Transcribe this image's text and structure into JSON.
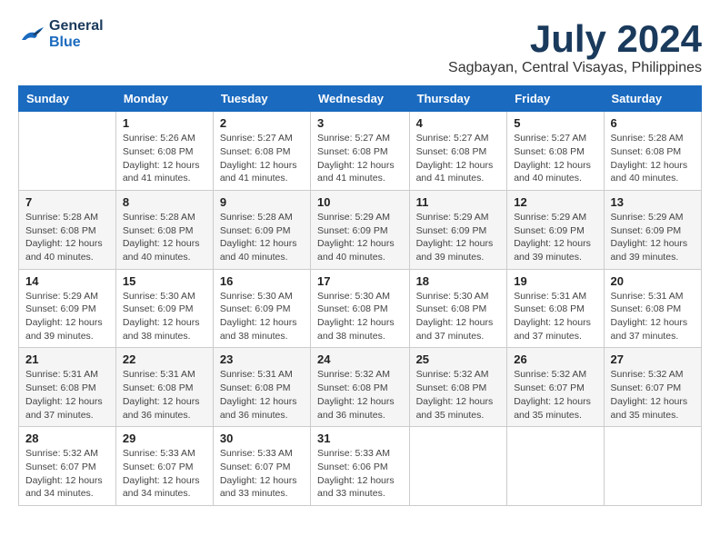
{
  "header": {
    "logo_general": "General",
    "logo_blue": "Blue",
    "month_title": "July 2024",
    "location": "Sagbayan, Central Visayas, Philippines"
  },
  "weekdays": [
    "Sunday",
    "Monday",
    "Tuesday",
    "Wednesday",
    "Thursday",
    "Friday",
    "Saturday"
  ],
  "weeks": [
    [
      {
        "day": "",
        "info": ""
      },
      {
        "day": "1",
        "info": "Sunrise: 5:26 AM\nSunset: 6:08 PM\nDaylight: 12 hours\nand 41 minutes."
      },
      {
        "day": "2",
        "info": "Sunrise: 5:27 AM\nSunset: 6:08 PM\nDaylight: 12 hours\nand 41 minutes."
      },
      {
        "day": "3",
        "info": "Sunrise: 5:27 AM\nSunset: 6:08 PM\nDaylight: 12 hours\nand 41 minutes."
      },
      {
        "day": "4",
        "info": "Sunrise: 5:27 AM\nSunset: 6:08 PM\nDaylight: 12 hours\nand 41 minutes."
      },
      {
        "day": "5",
        "info": "Sunrise: 5:27 AM\nSunset: 6:08 PM\nDaylight: 12 hours\nand 40 minutes."
      },
      {
        "day": "6",
        "info": "Sunrise: 5:28 AM\nSunset: 6:08 PM\nDaylight: 12 hours\nand 40 minutes."
      }
    ],
    [
      {
        "day": "7",
        "info": "Sunrise: 5:28 AM\nSunset: 6:08 PM\nDaylight: 12 hours\nand 40 minutes."
      },
      {
        "day": "8",
        "info": "Sunrise: 5:28 AM\nSunset: 6:08 PM\nDaylight: 12 hours\nand 40 minutes."
      },
      {
        "day": "9",
        "info": "Sunrise: 5:28 AM\nSunset: 6:09 PM\nDaylight: 12 hours\nand 40 minutes."
      },
      {
        "day": "10",
        "info": "Sunrise: 5:29 AM\nSunset: 6:09 PM\nDaylight: 12 hours\nand 40 minutes."
      },
      {
        "day": "11",
        "info": "Sunrise: 5:29 AM\nSunset: 6:09 PM\nDaylight: 12 hours\nand 39 minutes."
      },
      {
        "day": "12",
        "info": "Sunrise: 5:29 AM\nSunset: 6:09 PM\nDaylight: 12 hours\nand 39 minutes."
      },
      {
        "day": "13",
        "info": "Sunrise: 5:29 AM\nSunset: 6:09 PM\nDaylight: 12 hours\nand 39 minutes."
      }
    ],
    [
      {
        "day": "14",
        "info": "Sunrise: 5:29 AM\nSunset: 6:09 PM\nDaylight: 12 hours\nand 39 minutes."
      },
      {
        "day": "15",
        "info": "Sunrise: 5:30 AM\nSunset: 6:09 PM\nDaylight: 12 hours\nand 38 minutes."
      },
      {
        "day": "16",
        "info": "Sunrise: 5:30 AM\nSunset: 6:09 PM\nDaylight: 12 hours\nand 38 minutes."
      },
      {
        "day": "17",
        "info": "Sunrise: 5:30 AM\nSunset: 6:08 PM\nDaylight: 12 hours\nand 38 minutes."
      },
      {
        "day": "18",
        "info": "Sunrise: 5:30 AM\nSunset: 6:08 PM\nDaylight: 12 hours\nand 37 minutes."
      },
      {
        "day": "19",
        "info": "Sunrise: 5:31 AM\nSunset: 6:08 PM\nDaylight: 12 hours\nand 37 minutes."
      },
      {
        "day": "20",
        "info": "Sunrise: 5:31 AM\nSunset: 6:08 PM\nDaylight: 12 hours\nand 37 minutes."
      }
    ],
    [
      {
        "day": "21",
        "info": "Sunrise: 5:31 AM\nSunset: 6:08 PM\nDaylight: 12 hours\nand 37 minutes."
      },
      {
        "day": "22",
        "info": "Sunrise: 5:31 AM\nSunset: 6:08 PM\nDaylight: 12 hours\nand 36 minutes."
      },
      {
        "day": "23",
        "info": "Sunrise: 5:31 AM\nSunset: 6:08 PM\nDaylight: 12 hours\nand 36 minutes."
      },
      {
        "day": "24",
        "info": "Sunrise: 5:32 AM\nSunset: 6:08 PM\nDaylight: 12 hours\nand 36 minutes."
      },
      {
        "day": "25",
        "info": "Sunrise: 5:32 AM\nSunset: 6:08 PM\nDaylight: 12 hours\nand 35 minutes."
      },
      {
        "day": "26",
        "info": "Sunrise: 5:32 AM\nSunset: 6:07 PM\nDaylight: 12 hours\nand 35 minutes."
      },
      {
        "day": "27",
        "info": "Sunrise: 5:32 AM\nSunset: 6:07 PM\nDaylight: 12 hours\nand 35 minutes."
      }
    ],
    [
      {
        "day": "28",
        "info": "Sunrise: 5:32 AM\nSunset: 6:07 PM\nDaylight: 12 hours\nand 34 minutes."
      },
      {
        "day": "29",
        "info": "Sunrise: 5:33 AM\nSunset: 6:07 PM\nDaylight: 12 hours\nand 34 minutes."
      },
      {
        "day": "30",
        "info": "Sunrise: 5:33 AM\nSunset: 6:07 PM\nDaylight: 12 hours\nand 33 minutes."
      },
      {
        "day": "31",
        "info": "Sunrise: 5:33 AM\nSunset: 6:06 PM\nDaylight: 12 hours\nand 33 minutes."
      },
      {
        "day": "",
        "info": ""
      },
      {
        "day": "",
        "info": ""
      },
      {
        "day": "",
        "info": ""
      }
    ]
  ]
}
